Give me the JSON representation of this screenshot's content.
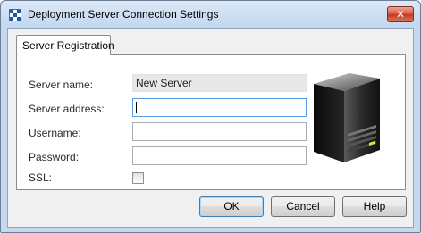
{
  "window": {
    "title": "Deployment Server Connection Settings",
    "close_glyph": "✕"
  },
  "tabs": [
    {
      "label": "Server Registration",
      "selected": true
    }
  ],
  "form": {
    "server_name_label": "Server name:",
    "server_name_value": "New Server",
    "server_address_label": "Server address:",
    "server_address_value": "",
    "username_label": "Username:",
    "username_value": "",
    "password_label": "Password:",
    "password_value": "",
    "ssl_label": "SSL:",
    "ssl_checked": false
  },
  "image": {
    "icon": "server-tower-icon"
  },
  "buttons": {
    "ok": "OK",
    "cancel": "Cancel",
    "help": "Help"
  },
  "colors": {
    "accent": "#569de5",
    "close": "#c4361f",
    "title_bar": "#c5d8ee"
  }
}
